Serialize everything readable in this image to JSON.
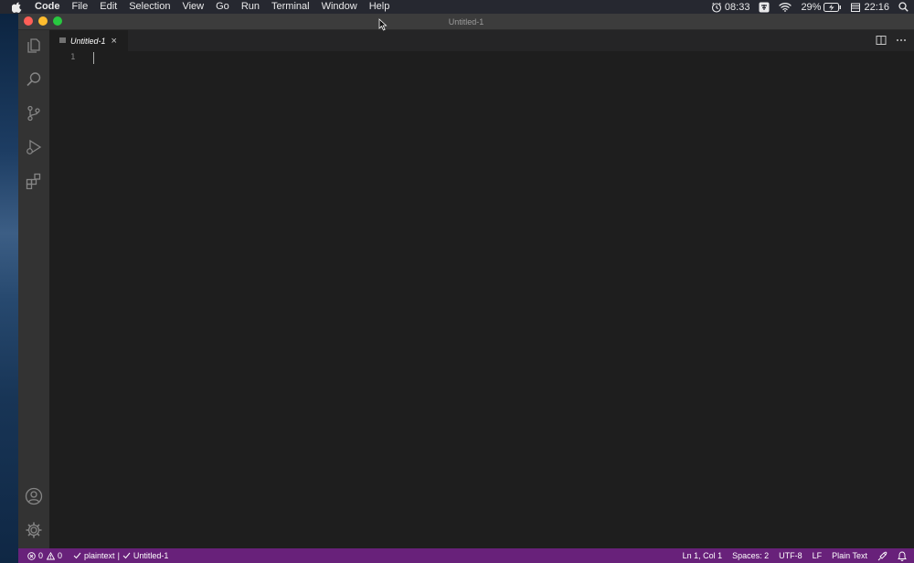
{
  "menubar": {
    "app_name": "Code",
    "items": [
      "File",
      "Edit",
      "Selection",
      "View",
      "Go",
      "Run",
      "Terminal",
      "Window",
      "Help"
    ],
    "timer": "08:33",
    "battery": "29%",
    "clock": "22:16"
  },
  "window": {
    "title": "Untitled-1",
    "lights": {
      "close": "#ff5f57",
      "minimize": "#febc2e",
      "zoom": "#28c840"
    }
  },
  "activity_bar": {
    "top_icons": [
      "explorer-icon",
      "search-icon",
      "source-control-icon",
      "run-debug-icon",
      "extensions-icon"
    ],
    "bottom_icons": [
      "accounts-icon",
      "manage-gear-icon"
    ]
  },
  "tabs": [
    {
      "label": "Untitled-1",
      "icon": "plaintext-file-icon",
      "close": "×"
    }
  ],
  "editor": {
    "line_numbers": [
      "1"
    ]
  },
  "statusbar": {
    "color": "#68217a",
    "errors": "0",
    "warnings": "0",
    "language_check": "plaintext",
    "separator": "|",
    "file_check": "Untitled-1",
    "cursor_position": "Ln 1, Col 1",
    "spaces": "Spaces: 2",
    "encoding": "UTF-8",
    "eol": "LF",
    "language_mode": "Plain Text"
  }
}
